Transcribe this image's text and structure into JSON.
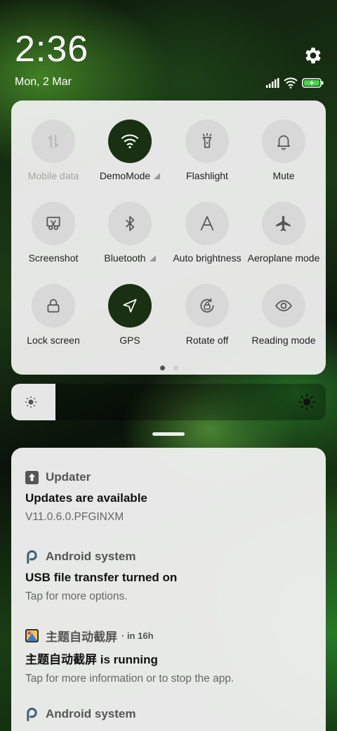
{
  "status": {
    "time": "2:36",
    "date": "Mon, 2 Mar",
    "icons": [
      "signal-icon",
      "wifi-icon",
      "battery-charging-icon"
    ]
  },
  "quick_settings": {
    "tiles": [
      {
        "label": "Mobile data",
        "icon": "mobile-data-icon",
        "active": false,
        "disabled": true,
        "has_menu": false
      },
      {
        "label": "DemoMode",
        "icon": "wifi-icon",
        "active": true,
        "disabled": false,
        "has_menu": true
      },
      {
        "label": "Flashlight",
        "icon": "flashlight-icon",
        "active": false,
        "disabled": false,
        "has_menu": false
      },
      {
        "label": "Mute",
        "icon": "bell-icon",
        "active": false,
        "disabled": false,
        "has_menu": false
      },
      {
        "label": "Screenshot",
        "icon": "screenshot-icon",
        "active": false,
        "disabled": false,
        "has_menu": false
      },
      {
        "label": "Bluetooth",
        "icon": "bluetooth-icon",
        "active": false,
        "disabled": false,
        "has_menu": true
      },
      {
        "label": "Auto brightness",
        "icon": "auto-brightness-icon",
        "active": false,
        "disabled": false,
        "has_menu": false
      },
      {
        "label": "Aeroplane mode",
        "icon": "airplane-icon",
        "active": false,
        "disabled": false,
        "has_menu": false
      },
      {
        "label": "Lock screen",
        "icon": "lock-icon",
        "active": false,
        "disabled": false,
        "has_menu": false
      },
      {
        "label": "GPS",
        "icon": "navigation-arrow-icon",
        "active": true,
        "disabled": false,
        "has_menu": false
      },
      {
        "label": "Rotate off",
        "icon": "rotation-lock-icon",
        "active": false,
        "disabled": false,
        "has_menu": false
      },
      {
        "label": "Reading mode",
        "icon": "eye-icon",
        "active": false,
        "disabled": false,
        "has_menu": false
      }
    ],
    "page_count": 2,
    "current_page": 1
  },
  "brightness": {
    "level": 0.14
  },
  "notifications": [
    {
      "app": "Updater",
      "app_icon": "updater-icon",
      "time": "",
      "title": "Updates are available",
      "body": "V11.0.6.0.PFGINXM"
    },
    {
      "app": "Android system",
      "app_icon": "android-system-icon",
      "time": "",
      "title": "USB file transfer turned on",
      "body": "Tap for more options."
    },
    {
      "app": "主题自动截屏",
      "app_icon": "theme-app-icon",
      "time": "· in 16h",
      "title": "主题自动截屏 is running",
      "body": "Tap for more information or to stop the app."
    },
    {
      "app": "Android system",
      "app_icon": "android-system-icon",
      "time": "",
      "title": "",
      "body": ""
    }
  ],
  "colors": {
    "tile_active": "#1a3013",
    "tile_inactive": "#d8d8d8",
    "panel_bg": "#f0f0f0",
    "battery": "#3ddc44"
  }
}
